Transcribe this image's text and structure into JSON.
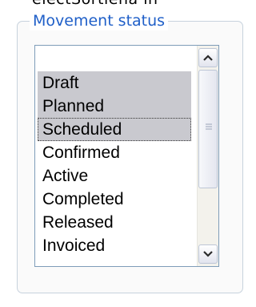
{
  "top_partial_text": "electSortlena in",
  "group": {
    "legend": "Movement status"
  },
  "listbox": {
    "items": [
      {
        "label": "",
        "selected": false
      },
      {
        "label": "Draft",
        "selected": true
      },
      {
        "label": "Planned",
        "selected": true
      },
      {
        "label": "Scheduled",
        "selected": true,
        "focused": true
      },
      {
        "label": "Confirmed",
        "selected": false
      },
      {
        "label": "Active",
        "selected": false
      },
      {
        "label": "Completed",
        "selected": false
      },
      {
        "label": "Released",
        "selected": false
      },
      {
        "label": "Invoiced",
        "selected": false
      }
    ],
    "scroll_up_icon": "scroll-up-arrow-icon",
    "scroll_down_icon": "scroll-down-arrow-icon",
    "thumb_grip_icon": "scroll-grip-icon"
  },
  "colors": {
    "legend": "#1f5fc8",
    "selection": "#c9c9cf",
    "group_border": "#c7d2dd",
    "list_border": "#7f9db9"
  }
}
